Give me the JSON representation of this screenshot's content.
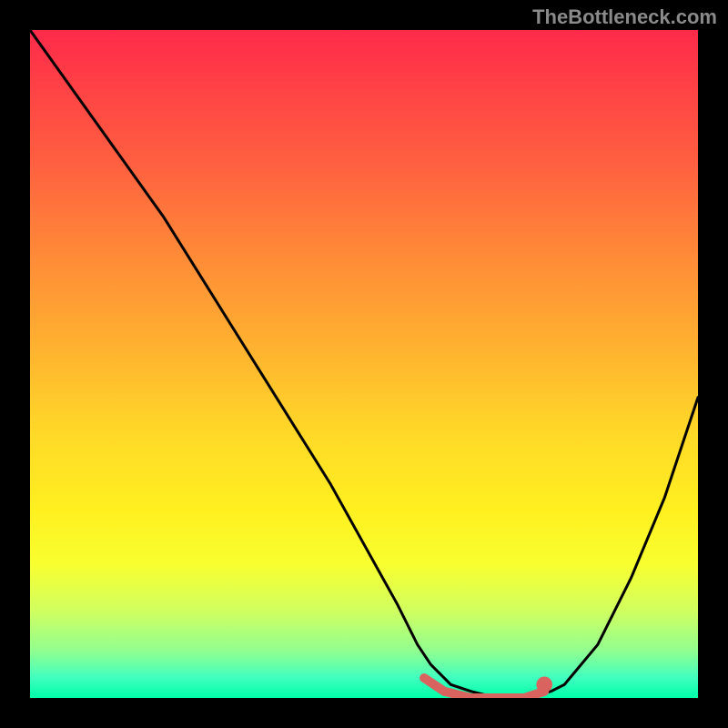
{
  "watermark": "TheBottleneck.com",
  "chart_data": {
    "type": "line",
    "title": "",
    "xlabel": "",
    "ylabel": "",
    "xlim": [
      0,
      100
    ],
    "ylim": [
      0,
      100
    ],
    "series": [
      {
        "name": "bottleneck-curve",
        "x": [
          0,
          5,
          10,
          15,
          20,
          25,
          30,
          35,
          40,
          45,
          50,
          55,
          58,
          60,
          63,
          66,
          70,
          74,
          78,
          80,
          85,
          90,
          95,
          100
        ],
        "values": [
          100,
          93,
          86,
          79,
          72,
          64,
          56,
          48,
          40,
          32,
          23,
          14,
          8,
          5,
          2,
          1,
          0,
          0,
          1,
          2,
          8,
          18,
          30,
          45
        ]
      },
      {
        "name": "highlight-region",
        "x": [
          59,
          62,
          66,
          70,
          74,
          77
        ],
        "values": [
          3,
          1,
          0,
          0,
          0,
          1
        ]
      }
    ],
    "gradient_colors": {
      "top": "#ff2a4a",
      "mid": "#ffe030",
      "bottom": "#00ffaa"
    },
    "highlight_color": "#d9645f",
    "highlight_dot": {
      "x": 77,
      "y": 2,
      "r": 1.2
    }
  }
}
